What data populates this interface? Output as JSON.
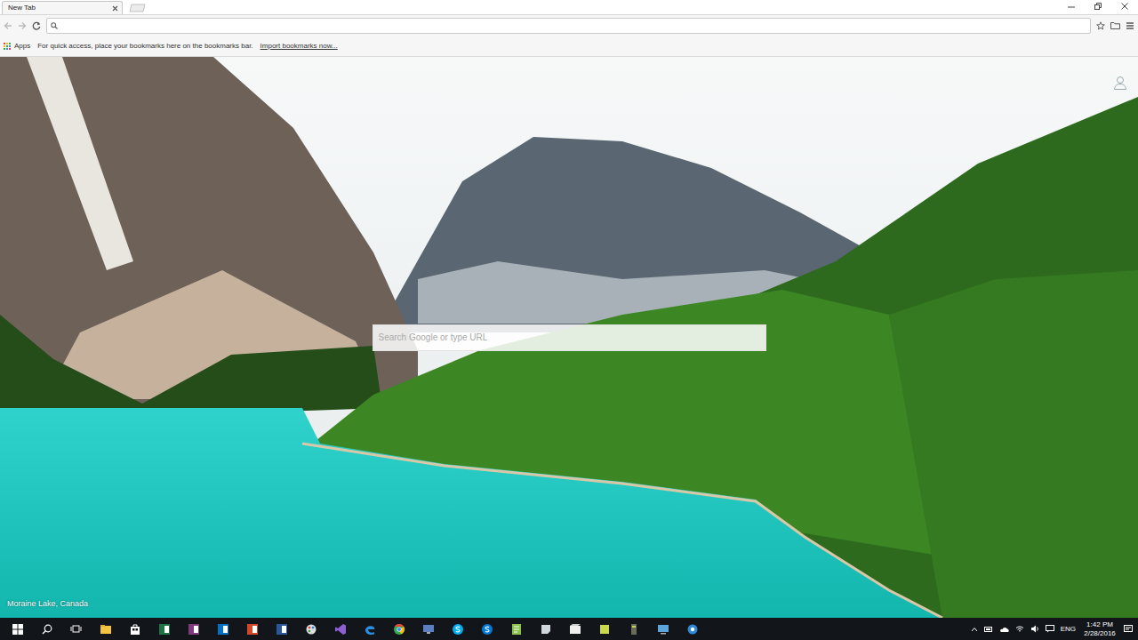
{
  "tabs": [
    {
      "label": "New Tab",
      "selected": true
    }
  ],
  "bookmarks_bar": {
    "apps": "Apps",
    "hint": "For quick access, place your bookmarks here on the bookmarks bar.",
    "import_link": "Import bookmarks now..."
  },
  "page": {
    "search_placeholder": "Search Google or type URL",
    "caption": "Moraine Lake, Canada"
  },
  "taskbar": {
    "language": "ENG",
    "time": "1:42 PM",
    "date": "2/28/2016"
  }
}
